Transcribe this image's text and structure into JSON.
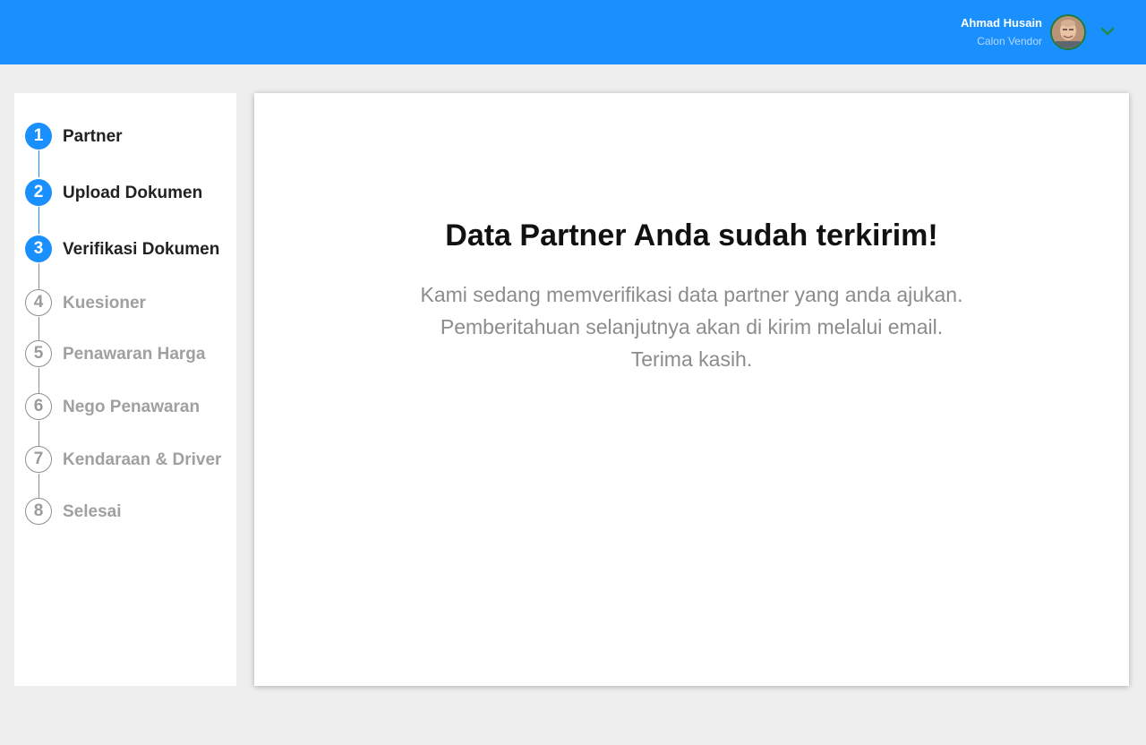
{
  "header": {
    "user_name": "Ahmad Husain",
    "user_role": "Calon Vendor",
    "brand_color": "#1a8ffe",
    "avatar_icon": "user-avatar",
    "menu_icon": "chevron-down-icon"
  },
  "sidebar": {
    "steps": [
      {
        "number": "1",
        "label": "Partner",
        "state": "active"
      },
      {
        "number": "2",
        "label": "Upload Dokumen",
        "state": "active"
      },
      {
        "number": "3",
        "label": "Verifikasi Dokumen",
        "state": "active"
      },
      {
        "number": "4",
        "label": "Kuesioner",
        "state": "inactive"
      },
      {
        "number": "5",
        "label": "Penawaran Harga",
        "state": "inactive"
      },
      {
        "number": "6",
        "label": "Nego Penawaran",
        "state": "inactive"
      },
      {
        "number": "7",
        "label": "Kendaraan & Driver",
        "state": "inactive"
      },
      {
        "number": "8",
        "label": "Selesai",
        "state": "inactive"
      }
    ]
  },
  "main": {
    "title": "Data Partner Anda sudah terkirim!",
    "message_lines": [
      "Kami sedang memverifikasi data partner yang anda ajukan.",
      "Pemberitahuan selanjutnya akan di kirim melalui email.",
      "Terima kasih."
    ]
  }
}
